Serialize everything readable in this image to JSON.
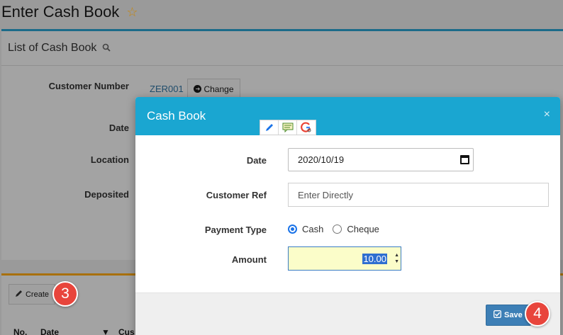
{
  "page": {
    "title": "Enter Cash Book",
    "star_icon": "star-outline-icon"
  },
  "list_panel": {
    "title": "List of Cash Book",
    "search_icon": "search-icon",
    "labels": {
      "customer_number": "Customer Number",
      "date": "Date",
      "location": "Location",
      "deposited": "Deposited"
    },
    "customer_number_value": "ZER001",
    "change_label": "Change"
  },
  "bottom_panel": {
    "create_label": "Create",
    "columns": [
      "No.",
      "Date",
      "Cus"
    ]
  },
  "modal": {
    "title": "Cash Book",
    "close": "×",
    "toolbar_icons": [
      "pencil-icon",
      "comment-icon",
      "google-search-icon"
    ],
    "fields": {
      "date_label": "Date",
      "date_value": "2020/10/19",
      "customer_ref_label": "Customer Ref",
      "customer_ref_placeholder": "Enter Directly",
      "payment_type_label": "Payment Type",
      "payment_options": [
        "Cash",
        "Cheque"
      ],
      "payment_selected": "Cash",
      "amount_label": "Amount",
      "amount_value": "10.00"
    },
    "save_label": "Save"
  },
  "step_badges": [
    "3",
    "4"
  ],
  "colors": {
    "modal_header": "#1aa6d1",
    "save_button": "#3d7fb6",
    "badge": "#e8453c",
    "amount_bg": "#fbfdc9"
  }
}
